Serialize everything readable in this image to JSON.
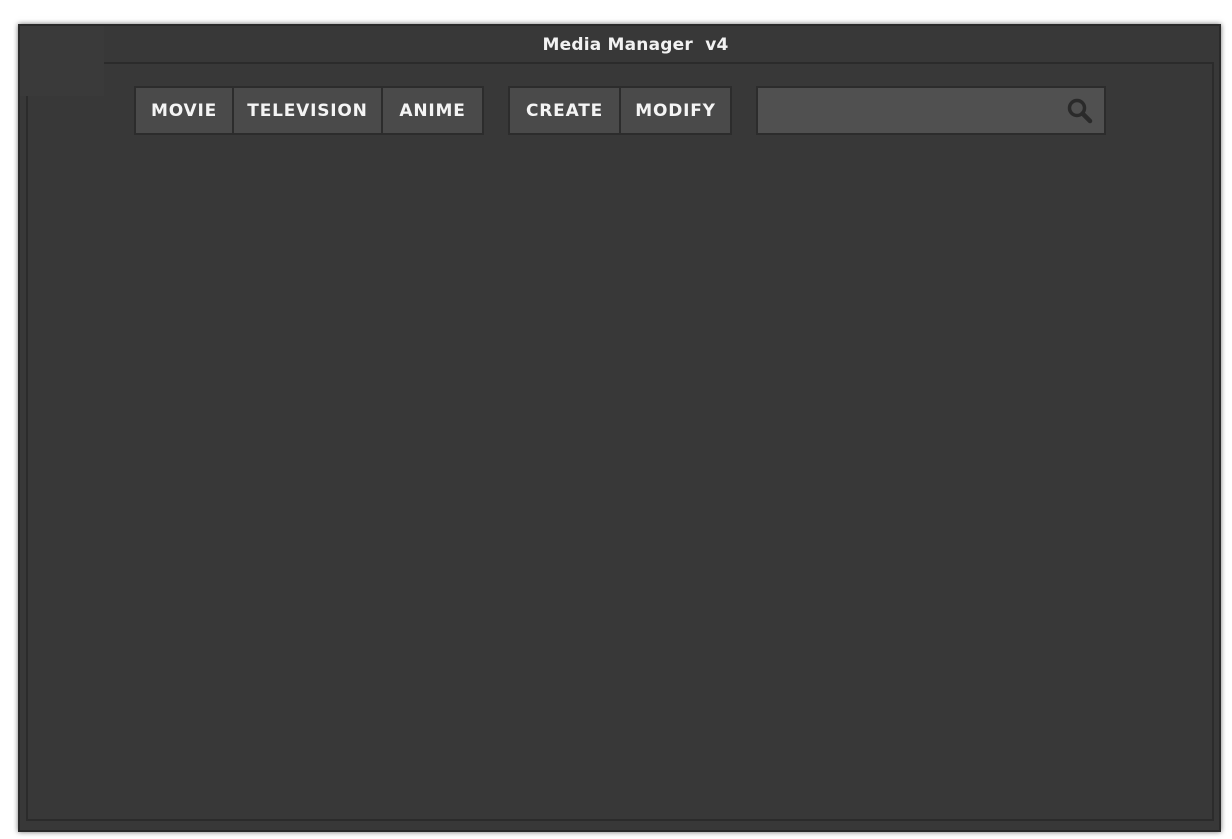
{
  "window": {
    "title": "Media Manager  v4"
  },
  "nav": {
    "items": [
      {
        "label": "MOVIE"
      },
      {
        "label": "TELEVISION"
      },
      {
        "label": "ANIME"
      }
    ]
  },
  "actions": {
    "items": [
      {
        "label": "CREATE"
      },
      {
        "label": "MODIFY"
      }
    ]
  },
  "search": {
    "value": "",
    "placeholder": "",
    "icon": "search-icon"
  },
  "colors": {
    "background": "#383838",
    "button": "#4a4a4a",
    "search_field": "#505050",
    "border": "#2c2c2c",
    "text": "#f4f4f4"
  }
}
